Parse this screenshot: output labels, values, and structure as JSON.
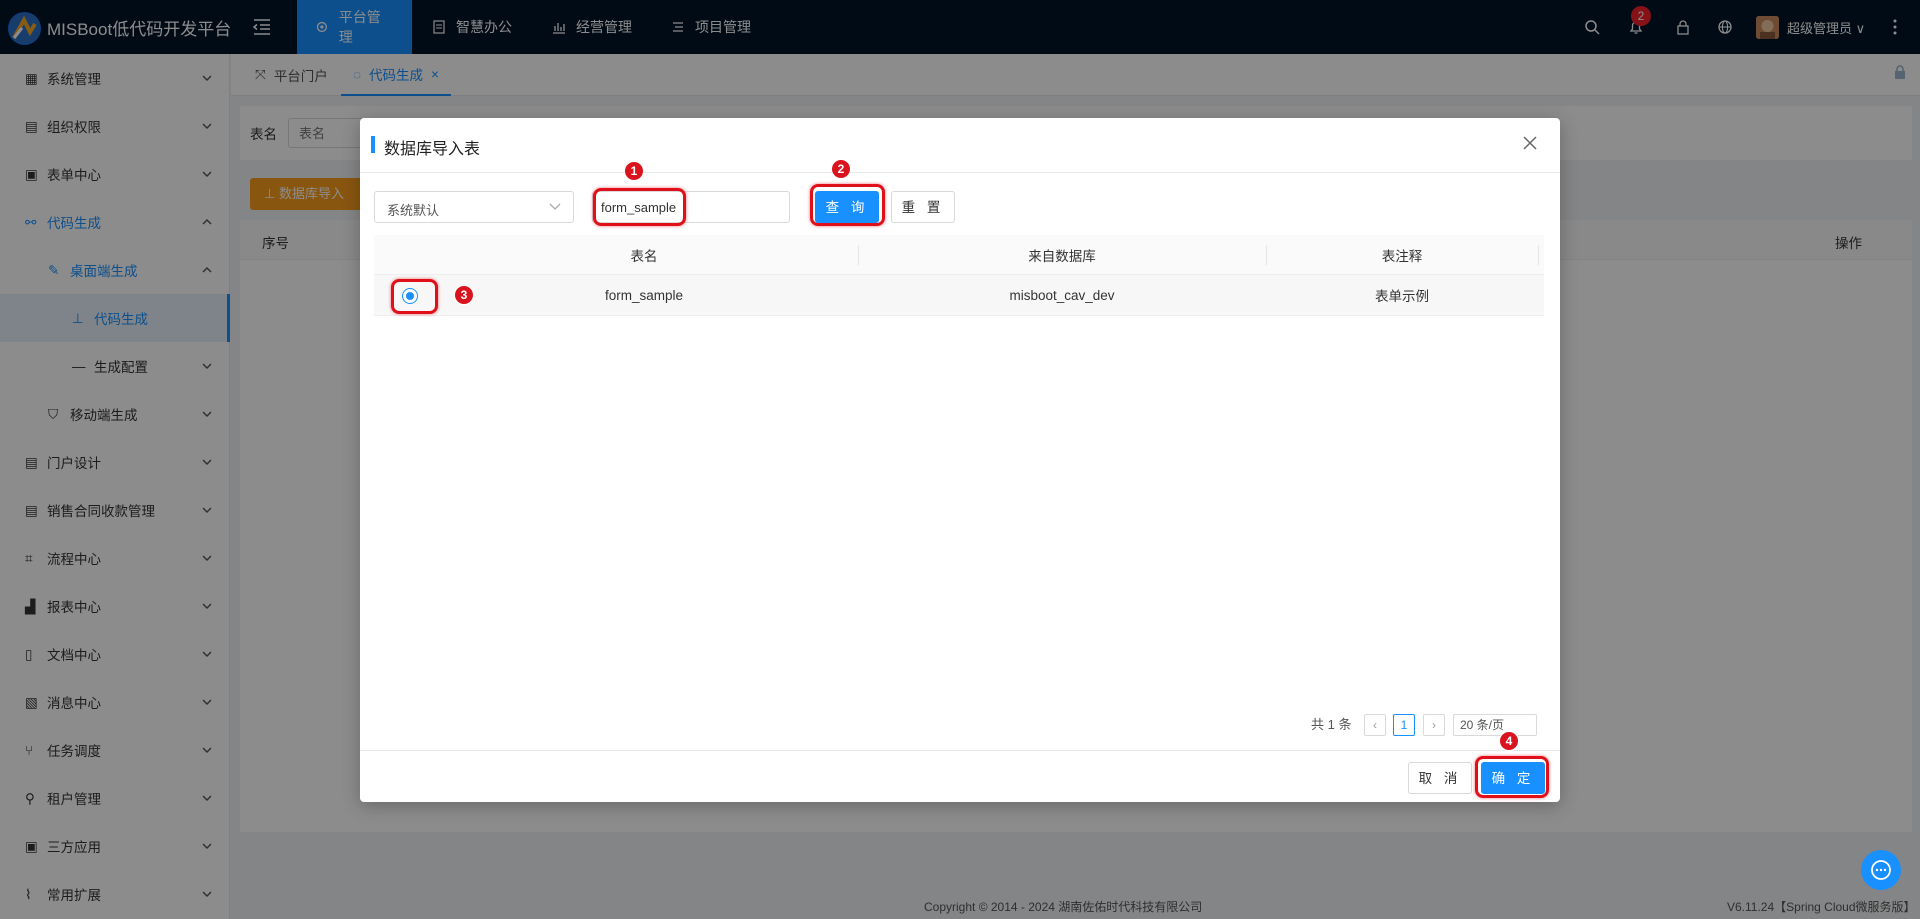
{
  "app": {
    "title": "MISBoot低代码开发平台"
  },
  "topnav": {
    "items": [
      {
        "label": "平台管理"
      },
      {
        "label": "智慧办公"
      },
      {
        "label": "经营管理"
      },
      {
        "label": "项目管理"
      }
    ],
    "notification_count": "2",
    "username": "超级管理员"
  },
  "sidebar": {
    "items": [
      {
        "label": "系统管理"
      },
      {
        "label": "组织权限"
      },
      {
        "label": "表单中心"
      },
      {
        "label": "代码生成"
      },
      {
        "label": "桌面端生成"
      },
      {
        "label": "代码生成"
      },
      {
        "label": "生成配置"
      },
      {
        "label": "移动端生成"
      },
      {
        "label": "门户设计"
      },
      {
        "label": "销售合同收款管理"
      },
      {
        "label": "流程中心"
      },
      {
        "label": "报表中心"
      },
      {
        "label": "文档中心"
      },
      {
        "label": "消息中心"
      },
      {
        "label": "任务调度"
      },
      {
        "label": "租户管理"
      },
      {
        "label": "三方应用"
      },
      {
        "label": "常用扩展"
      }
    ]
  },
  "tabs": [
    {
      "label": "平台门户"
    },
    {
      "label": "代码生成"
    }
  ],
  "background": {
    "filter_label": "表名",
    "filter_placeholder": "表名",
    "import_button": "数据库导入",
    "col_index": "序号",
    "col_action": "操作"
  },
  "modal": {
    "title": "数据库导入表",
    "datasource_select": "系统默认",
    "search_value": "form_sample",
    "query_button": "查 询",
    "reset_button": "重 置",
    "columns": [
      "表名",
      "来自数据库",
      "表注释"
    ],
    "rows": [
      {
        "table_name": "form_sample",
        "database": "misboot_cav_dev",
        "comment": "表单示例",
        "selected": true
      }
    ],
    "pagination": {
      "total_text": "共 1 条",
      "current_page": "1",
      "page_size": "20 条/页"
    },
    "cancel_button": "取 消",
    "confirm_button": "确 定"
  },
  "annotations": [
    "1",
    "2",
    "3",
    "4"
  ],
  "footer": {
    "copyright": "Copyright © 2014 - 2024 湖南佐佑时代科技有限公司",
    "version": "V6.11.24【Spring Cloud微服务版】"
  },
  "colors": {
    "primary": "#1890ff",
    "header_bg": "#001529",
    "highlight": "#e0101a"
  }
}
